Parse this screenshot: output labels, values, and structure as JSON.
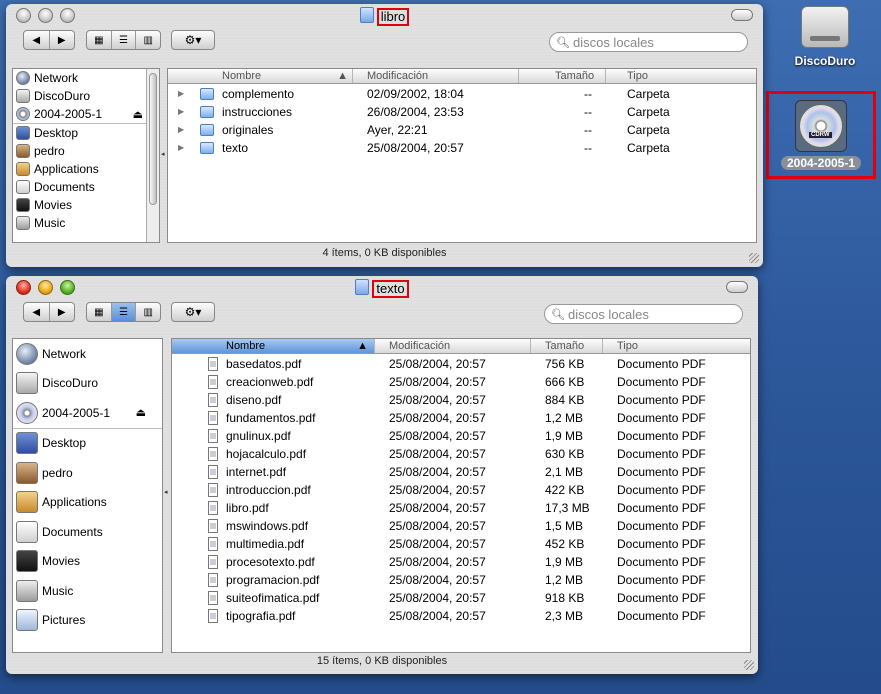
{
  "desktop": {
    "icons": [
      {
        "label": "DiscoDuro"
      },
      {
        "label": "2004-2005-1",
        "badge": "CDRW"
      }
    ]
  },
  "window_top": {
    "title": "libro",
    "search_placeholder": "discos locales",
    "sidebar": [
      {
        "label": "Network",
        "icon": "network-icon"
      },
      {
        "label": "DiscoDuro",
        "icon": "harddisk-icon"
      },
      {
        "label": "2004-2005-1",
        "icon": "cd-icon",
        "eject": "⏏"
      },
      {
        "label": "Desktop",
        "icon": "desktop-icon"
      },
      {
        "label": "pedro",
        "icon": "home-icon"
      },
      {
        "label": "Applications",
        "icon": "applications-icon"
      },
      {
        "label": "Documents",
        "icon": "documents-icon"
      },
      {
        "label": "Movies",
        "icon": "movies-icon"
      },
      {
        "label": "Music",
        "icon": "music-icon"
      }
    ],
    "columns": [
      "Nombre",
      "Modificación",
      "Tamaño",
      "Tipo"
    ],
    "rows": [
      {
        "name": "complemento",
        "modified": "02/09/2002, 18:04",
        "size": "--",
        "kind": "Carpeta"
      },
      {
        "name": "instrucciones",
        "modified": "26/08/2004, 23:53",
        "size": "--",
        "kind": "Carpeta"
      },
      {
        "name": "originales",
        "modified": "Ayer, 22:21",
        "size": "--",
        "kind": "Carpeta"
      },
      {
        "name": "texto",
        "modified": "25/08/2004, 20:57",
        "size": "--",
        "kind": "Carpeta"
      }
    ],
    "status": "4 ítems, 0 KB disponibles"
  },
  "window_bottom": {
    "title": "texto",
    "search_placeholder": "discos locales",
    "sidebar": [
      {
        "label": "Network",
        "icon": "network-icon"
      },
      {
        "label": "DiscoDuro",
        "icon": "harddisk-icon"
      },
      {
        "label": "2004-2005-1",
        "icon": "cd-icon",
        "eject": "⏏"
      },
      {
        "label": "Desktop",
        "icon": "desktop-icon"
      },
      {
        "label": "pedro",
        "icon": "home-icon"
      },
      {
        "label": "Applications",
        "icon": "applications-icon"
      },
      {
        "label": "Documents",
        "icon": "documents-icon"
      },
      {
        "label": "Movies",
        "icon": "movies-icon"
      },
      {
        "label": "Music",
        "icon": "music-icon"
      },
      {
        "label": "Pictures",
        "icon": "pictures-icon"
      }
    ],
    "columns": [
      "Nombre",
      "Modificación",
      "Tamaño",
      "Tipo"
    ],
    "rows": [
      {
        "name": "basedatos.pdf",
        "modified": "25/08/2004, 20:57",
        "size": "756 KB",
        "kind": "Documento PDF"
      },
      {
        "name": "creacionweb.pdf",
        "modified": "25/08/2004, 20:57",
        "size": "666 KB",
        "kind": "Documento PDF"
      },
      {
        "name": "diseno.pdf",
        "modified": "25/08/2004, 20:57",
        "size": "884 KB",
        "kind": "Documento PDF"
      },
      {
        "name": "fundamentos.pdf",
        "modified": "25/08/2004, 20:57",
        "size": "1,2 MB",
        "kind": "Documento PDF"
      },
      {
        "name": "gnulinux.pdf",
        "modified": "25/08/2004, 20:57",
        "size": "1,9 MB",
        "kind": "Documento PDF"
      },
      {
        "name": "hojacalculo.pdf",
        "modified": "25/08/2004, 20:57",
        "size": "630 KB",
        "kind": "Documento PDF"
      },
      {
        "name": "internet.pdf",
        "modified": "25/08/2004, 20:57",
        "size": "2,1 MB",
        "kind": "Documento PDF"
      },
      {
        "name": "introduccion.pdf",
        "modified": "25/08/2004, 20:57",
        "size": "422 KB",
        "kind": "Documento PDF"
      },
      {
        "name": "libro.pdf",
        "modified": "25/08/2004, 20:57",
        "size": "17,3 MB",
        "kind": "Documento PDF"
      },
      {
        "name": "mswindows.pdf",
        "modified": "25/08/2004, 20:57",
        "size": "1,5 MB",
        "kind": "Documento PDF"
      },
      {
        "name": "multimedia.pdf",
        "modified": "25/08/2004, 20:57",
        "size": "452 KB",
        "kind": "Documento PDF"
      },
      {
        "name": "procesotexto.pdf",
        "modified": "25/08/2004, 20:57",
        "size": "1,9 MB",
        "kind": "Documento PDF"
      },
      {
        "name": "programacion.pdf",
        "modified": "25/08/2004, 20:57",
        "size": "1,2 MB",
        "kind": "Documento PDF"
      },
      {
        "name": "suiteofimatica.pdf",
        "modified": "25/08/2004, 20:57",
        "size": "918 KB",
        "kind": "Documento PDF"
      },
      {
        "name": "tipografia.pdf",
        "modified": "25/08/2004, 20:57",
        "size": "2,3 MB",
        "kind": "Documento PDF"
      }
    ],
    "status": "15 ítems, 0 KB disponibles"
  },
  "colors": {
    "highlight": "#e00010",
    "selected_column": "#5f95da",
    "desktop": "#2f5fa3"
  }
}
